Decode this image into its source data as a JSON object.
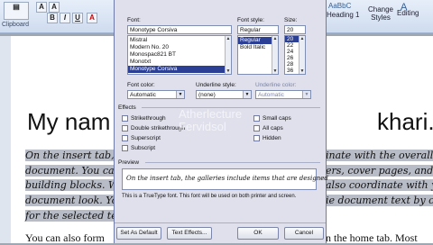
{
  "ribbon": {
    "clipboard_label": "Clipboard",
    "editing_label": "Editing",
    "styles_label": "Change Styles",
    "heading_gallery": "Heading 1",
    "aabbc": "AaBbC",
    "font_size_box": "A",
    "bold": "B",
    "italic": "I",
    "underline": "U"
  },
  "dialog": {
    "font_label": "Font:",
    "font_value": "Monotype Corsiva",
    "font_list": [
      "Mistral",
      "Modern No. 20",
      "Monospac821 BT",
      "Monotxt",
      "Monotype Corsiva"
    ],
    "font_selected_index": 4,
    "style_label": "Font style:",
    "style_value": "Regular",
    "style_list": [
      "Regular",
      "Bold Italic"
    ],
    "style_selected_index": 0,
    "size_label": "Size:",
    "size_value": "20",
    "size_list": [
      "20",
      "22",
      "24",
      "26",
      "28",
      "36"
    ],
    "size_selected_index": 0,
    "font_color_label": "Font color:",
    "font_color_value": "Automatic",
    "underline_style_label": "Underline style:",
    "underline_style_value": "(none)",
    "underline_color_label": "Underline color:",
    "underline_color_value": "Automatic",
    "effects_label": "Effects",
    "effects_left": [
      "Strikethrough",
      "Double strikethrough",
      "Superscript",
      "Subscript"
    ],
    "effects_right": [
      "Small caps",
      "All caps",
      "Hidden"
    ],
    "preview_label": "Preview",
    "preview_text": "On the insert tab, the galleries include items that are designed",
    "truetype_note": "This is a TrueType font. This font will be used on both printer and screen.",
    "set_default_label": "Set As Default",
    "text_effects_label": "Text Effects...",
    "ok_label": "OK",
    "cancel_label": "Cancel"
  },
  "document": {
    "heading_left": "My nam",
    "heading_right": "khari.",
    "lines": [
      "On the insert tab,",
      "document. You can",
      "building blocks. W",
      "document look. You",
      "for the selected text"
    ],
    "lines_right": [
      "inate with the overall lo",
      "ers, cover pages, and oth",
      "also coordinate with yo",
      "ie document text by choo",
      ""
    ],
    "plain_line_left": "You can also form",
    "plain_line_right": "n the home tab. Most"
  },
  "watermark": {
    "line1": "Atherlecture",
    "line2": "Fervidsol"
  }
}
